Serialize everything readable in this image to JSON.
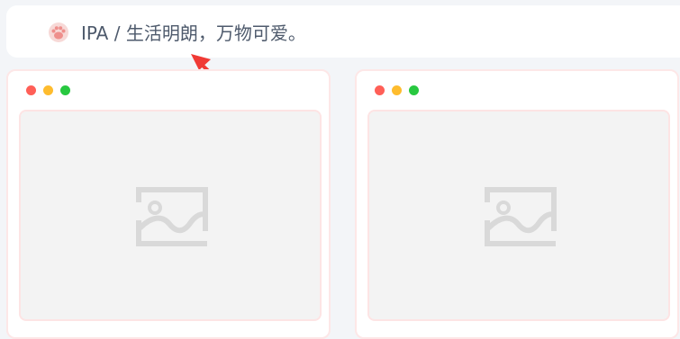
{
  "header": {
    "icon": "paw-icon",
    "breadcrumb_text": "IPA / 生活明朗，万物可爱。"
  },
  "annotation": {
    "icon": "red-arrow-icon",
    "color": "#f03a35"
  },
  "cards": [
    {
      "window_controls": [
        "close",
        "minimize",
        "maximize"
      ],
      "image_placeholder_icon": "image-placeholder-icon"
    },
    {
      "window_controls": [
        "close",
        "minimize",
        "maximize"
      ],
      "image_placeholder_icon": "image-placeholder-icon"
    }
  ],
  "colors": {
    "background": "#f3f5f8",
    "text": "#4e5a6c",
    "card_border": "#fde7e7",
    "dot_red": "#ff5f57",
    "dot_yellow": "#febc2e",
    "dot_green": "#28c840",
    "placeholder": "#f3f3f3"
  }
}
